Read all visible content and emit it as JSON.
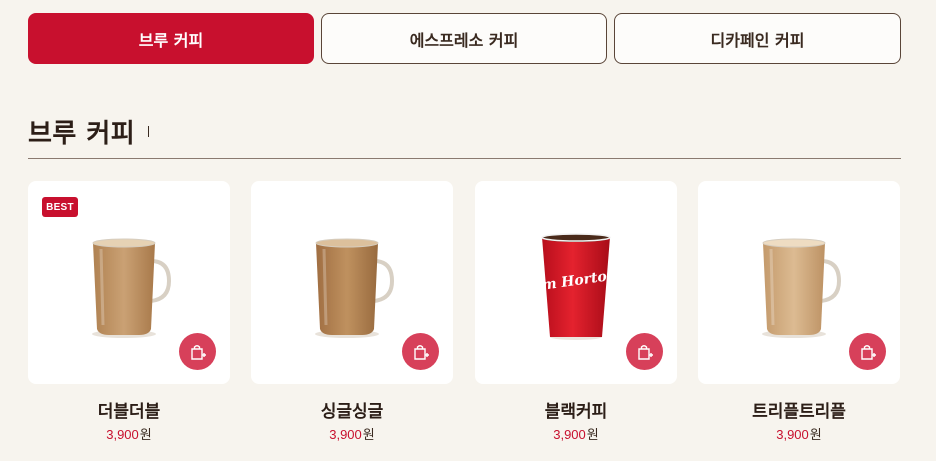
{
  "tabs": [
    {
      "label": "브루 커피",
      "active": true
    },
    {
      "label": "에스프레소 커피",
      "active": false
    },
    {
      "label": "디카페인 커피",
      "active": false
    }
  ],
  "section": {
    "title": "브루 커피"
  },
  "products": [
    {
      "name": "더블더블",
      "price": "3,900",
      "unit": "원",
      "badge": "BEST",
      "image": "latte-glass-mug",
      "cart_icon": "shopping-bag-plus-icon"
    },
    {
      "name": "싱글싱글",
      "price": "3,900",
      "unit": "원",
      "badge": "",
      "image": "latte-glass-mug",
      "cart_icon": "shopping-bag-plus-icon"
    },
    {
      "name": "블랙커피",
      "price": "3,900",
      "unit": "원",
      "badge": "",
      "image": "tim-hortons-red-cup",
      "cart_icon": "shopping-bag-plus-icon"
    },
    {
      "name": "트리플트리플",
      "price": "3,900",
      "unit": "원",
      "badge": "",
      "image": "light-latte-glass-mug",
      "cart_icon": "shopping-bag-plus-icon"
    }
  ],
  "cup_logo": "Tim Hortons",
  "colors": {
    "accent": "#c8102e",
    "cart_button": "#d7405a",
    "background": "#f7f4ee"
  }
}
